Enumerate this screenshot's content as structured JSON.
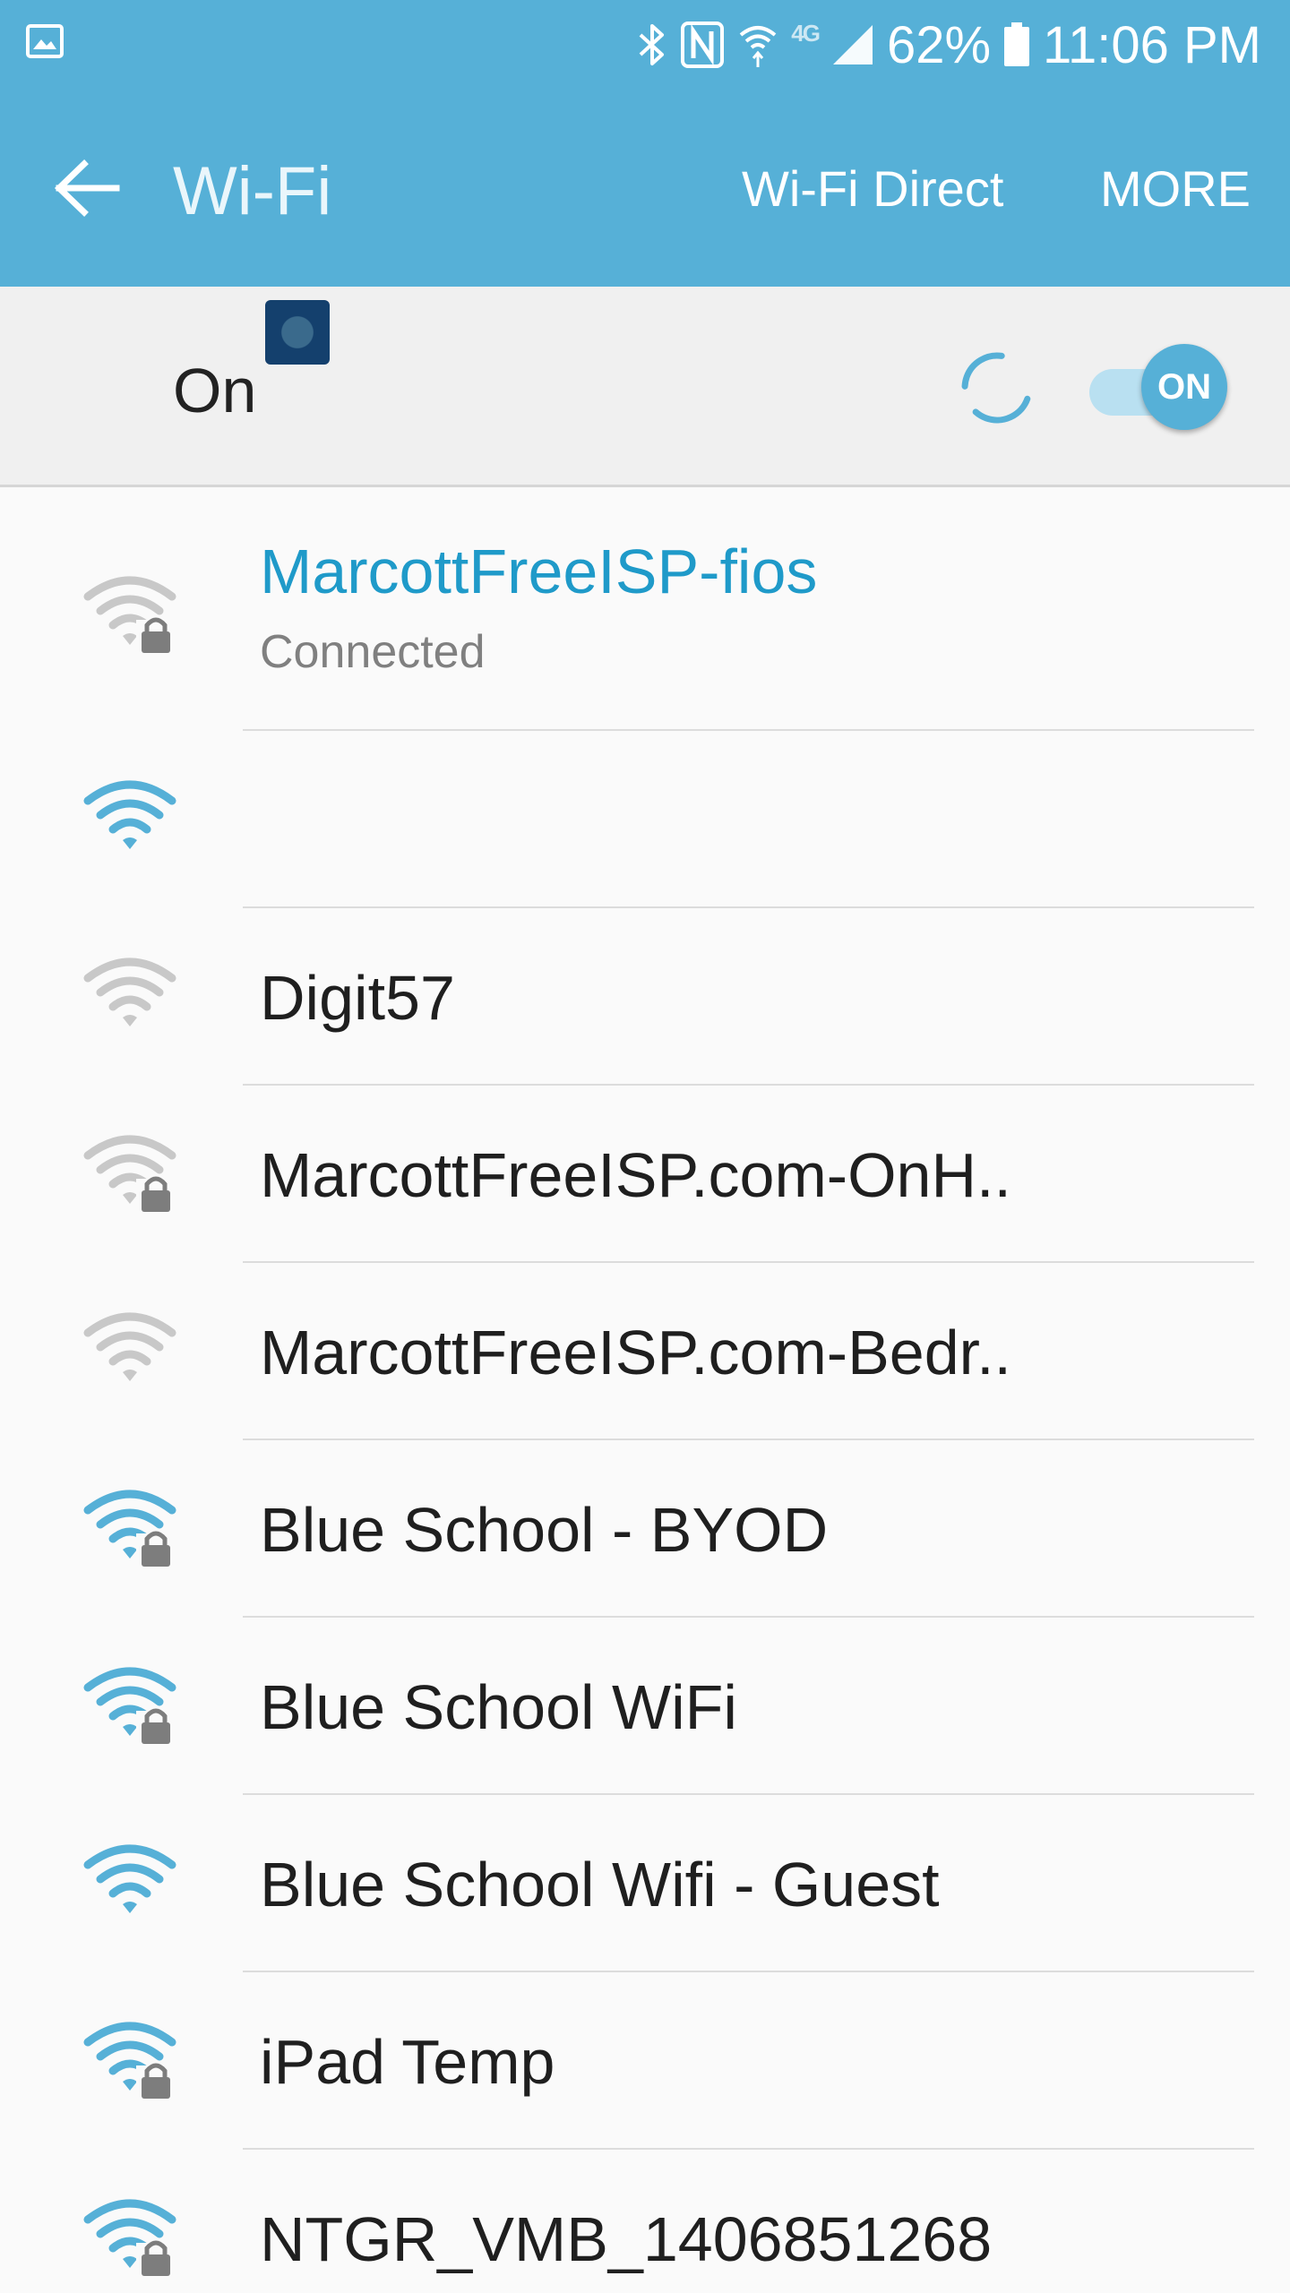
{
  "status_bar": {
    "battery_percent": "62%",
    "time": "11:06 PM",
    "network_type": "4G",
    "icons": [
      "gallery-icon",
      "bluetooth-icon",
      "nfc-icon",
      "wifi-calling-icon",
      "signal-icon",
      "battery-icon"
    ]
  },
  "app_bar": {
    "title": "Wi-Fi",
    "wifi_direct_label": "Wi-Fi Direct",
    "more_label": "MORE"
  },
  "master_switch": {
    "label": "On",
    "toggle_text": "ON"
  },
  "networks": [
    {
      "ssid": "MarcottFreeISP-fios",
      "status": "Connected",
      "secured": true,
      "strength": "strong",
      "color": "#c8c8c8"
    },
    {
      "ssid": "",
      "secured": false,
      "strength": "strong",
      "color": "#56b0d7",
      "ssid_is_image": true
    },
    {
      "ssid": "Digit57",
      "secured": false,
      "strength": "strong",
      "color": "#c8c8c8"
    },
    {
      "ssid": "MarcottFreeISP.com-OnH..",
      "secured": true,
      "strength": "strong",
      "color": "#c8c8c8"
    },
    {
      "ssid": "MarcottFreeISP.com-Bedr..",
      "secured": false,
      "strength": "strong",
      "color": "#c8c8c8"
    },
    {
      "ssid": "Blue School - BYOD",
      "secured": true,
      "strength": "strong",
      "color": "#56b0d7"
    },
    {
      "ssid": "Blue School WiFi",
      "secured": true,
      "strength": "strong",
      "color": "#56b0d7"
    },
    {
      "ssid": "Blue School Wifi - Guest",
      "secured": false,
      "strength": "strong",
      "color": "#56b0d7"
    },
    {
      "ssid": "iPad Temp",
      "secured": true,
      "strength": "strong",
      "color": "#56b0d7"
    },
    {
      "ssid": "NTGR_VMB_1406851268",
      "secured": true,
      "strength": "strong",
      "color": "#56b0d7"
    }
  ],
  "colors": {
    "accent": "#56b0d7",
    "connected_text": "#1f9ac9",
    "lock": "#7d7d7d"
  }
}
